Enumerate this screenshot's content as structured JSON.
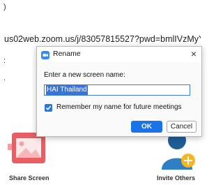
{
  "background": {
    "url_text": "us02web.zoom.us/j/83057815527?pwd=bmlIVzMyY...",
    "fragments": [
      ")",
      ":",
      "."
    ],
    "share_screen_label": "Share Screen",
    "invite_others_label": "Invite Others"
  },
  "dialog": {
    "title": "Rename",
    "prompt": "Enter a new screen name:",
    "name_value": "HAI Thailand",
    "remember_label": "Remember my name for future meetings",
    "remember_checked": true,
    "ok_label": "OK",
    "cancel_label": "Cancel",
    "close_glyph": "×"
  },
  "colors": {
    "accent": "#1a73e8",
    "share_icon": "#e8585c",
    "invite_icon": "#f5b621"
  }
}
